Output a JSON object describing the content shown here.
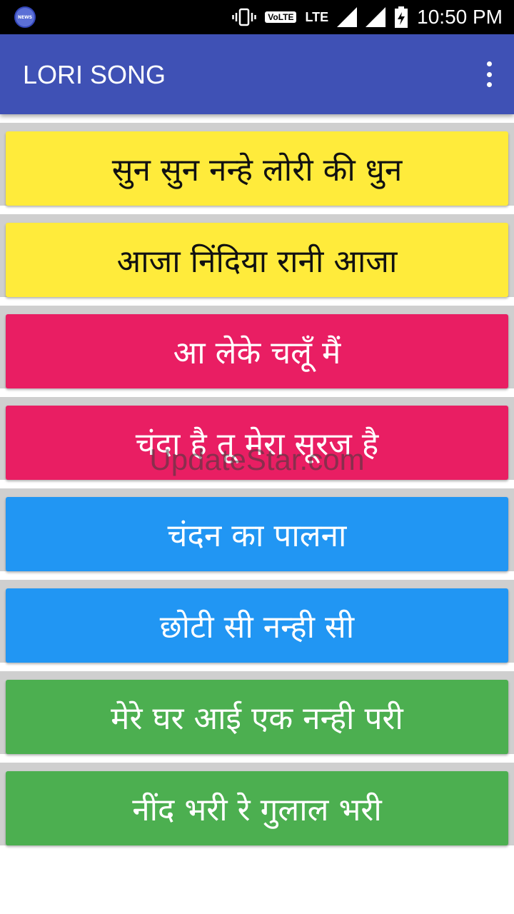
{
  "status_bar": {
    "news_icon_label": "NEWS",
    "volte": "VoLTE",
    "lte": "LTE",
    "time": "10:50 PM"
  },
  "app_bar": {
    "title": "LORI SONG"
  },
  "songs": [
    {
      "label": "सुन सुन नन्हे लोरी की धुन",
      "bg": "#ffeb3b",
      "fg": "#111111"
    },
    {
      "label": "आजा निंदिया रानी आजा",
      "bg": "#ffeb3b",
      "fg": "#111111"
    },
    {
      "label": "आ लेके चलूँ मैं",
      "bg": "#e91e63",
      "fg": "#ffffff"
    },
    {
      "label": "चंदा है तू मेरा सूरज है",
      "bg": "#e91e63",
      "fg": "#ffffff"
    },
    {
      "label": "चंदन का पालना",
      "bg": "#2196f3",
      "fg": "#ffffff"
    },
    {
      "label": "छोटी सी नन्ही सी",
      "bg": "#2196f3",
      "fg": "#ffffff"
    },
    {
      "label": "मेरे घर आई एक नन्ही परी",
      "bg": "#4caf50",
      "fg": "#ffffff"
    },
    {
      "label": "नींद भरी रे गुलाल भरी",
      "bg": "#4caf50",
      "fg": "#ffffff"
    }
  ],
  "watermark": "UpdateStar.com",
  "colors": {
    "app_bar": "#3f51b5",
    "status_bar": "#000000"
  }
}
